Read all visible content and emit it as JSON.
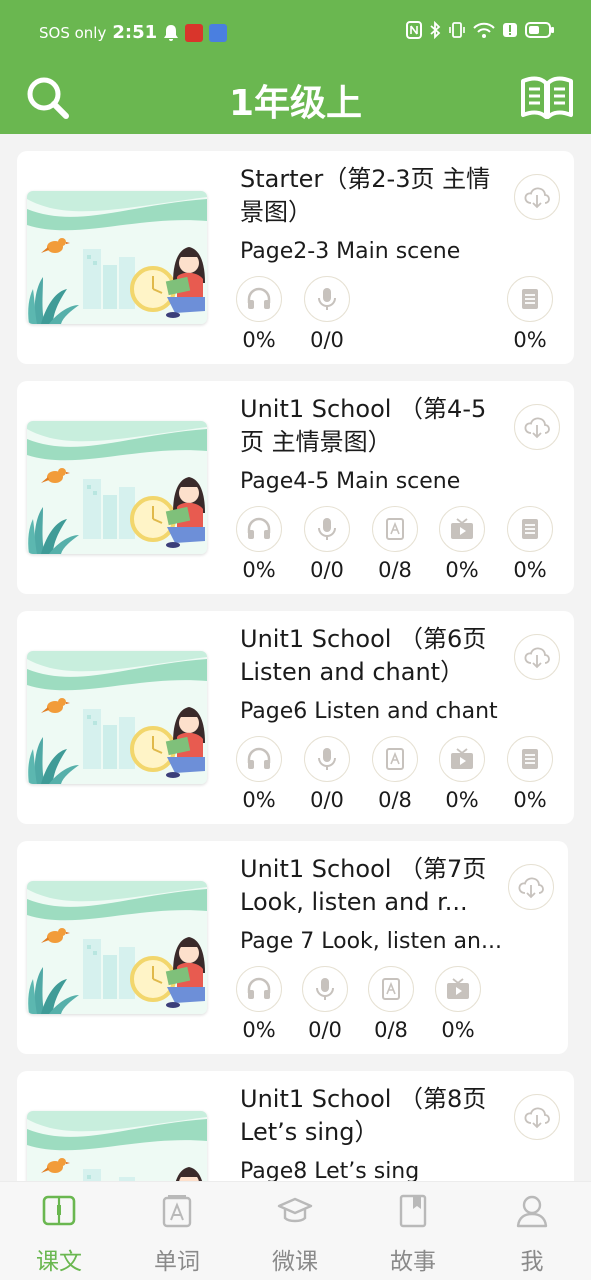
{
  "status_bar": {
    "sos": "SOS only",
    "time": "2:51"
  },
  "header": {
    "title": "1年级上",
    "search_icon": "search-icon",
    "book_icon": "open-book-icon"
  },
  "colors": {
    "primary": "#6ab750",
    "card_bg": "#ffffff",
    "page_bg": "#f3f3f3",
    "icon_grey": "#c7c2bd",
    "circle_border": "#e6e1d3"
  },
  "lessons": [
    {
      "title": "Starter（第2-3页 主情景图）",
      "subtitle": "Page2-3 Main scene",
      "stats": [
        {
          "icon": "headphones-icon",
          "value": "0%"
        },
        {
          "icon": "microphone-icon",
          "value": "0/0"
        },
        {
          "icon": "document-icon",
          "value": "0%"
        }
      ]
    },
    {
      "title": "Unit1 School （第4-5页 主情景图）",
      "subtitle": "Page4-5 Main scene",
      "stats": [
        {
          "icon": "headphones-icon",
          "value": "0%"
        },
        {
          "icon": "microphone-icon",
          "value": "0/0"
        },
        {
          "icon": "word-card-icon",
          "value": "0/8"
        },
        {
          "icon": "video-icon",
          "value": "0%"
        },
        {
          "icon": "document-icon",
          "value": "0%"
        }
      ]
    },
    {
      "title": "Unit1 School （第6页 Listen and chant）",
      "subtitle": "Page6 Listen and chant",
      "stats": [
        {
          "icon": "headphones-icon",
          "value": "0%"
        },
        {
          "icon": "microphone-icon",
          "value": "0/0"
        },
        {
          "icon": "word-card-icon",
          "value": "0/8"
        },
        {
          "icon": "video-icon",
          "value": "0%"
        },
        {
          "icon": "document-icon",
          "value": "0%"
        }
      ]
    },
    {
      "title": "Unit1 School （第7页 Look, listen and r...",
      "subtitle": "Page 7 Look, listen an...",
      "stats": [
        {
          "icon": "headphones-icon",
          "value": "0%"
        },
        {
          "icon": "microphone-icon",
          "value": "0/0"
        },
        {
          "icon": "word-card-icon",
          "value": "0/8"
        },
        {
          "icon": "video-icon",
          "value": "0%"
        }
      ]
    },
    {
      "title": "Unit1 School （第8页 Let’s sing）",
      "subtitle": "Page8 Let’s sing",
      "stats": []
    }
  ],
  "bottom_nav": [
    {
      "label": "课文",
      "icon": "textbook-icon",
      "active": true
    },
    {
      "label": "单词",
      "icon": "word-card-icon",
      "active": false
    },
    {
      "label": "微课",
      "icon": "graduation-cap-icon",
      "active": false
    },
    {
      "label": "故事",
      "icon": "bookmark-book-icon",
      "active": false
    },
    {
      "label": "我",
      "icon": "user-icon",
      "active": false
    }
  ]
}
